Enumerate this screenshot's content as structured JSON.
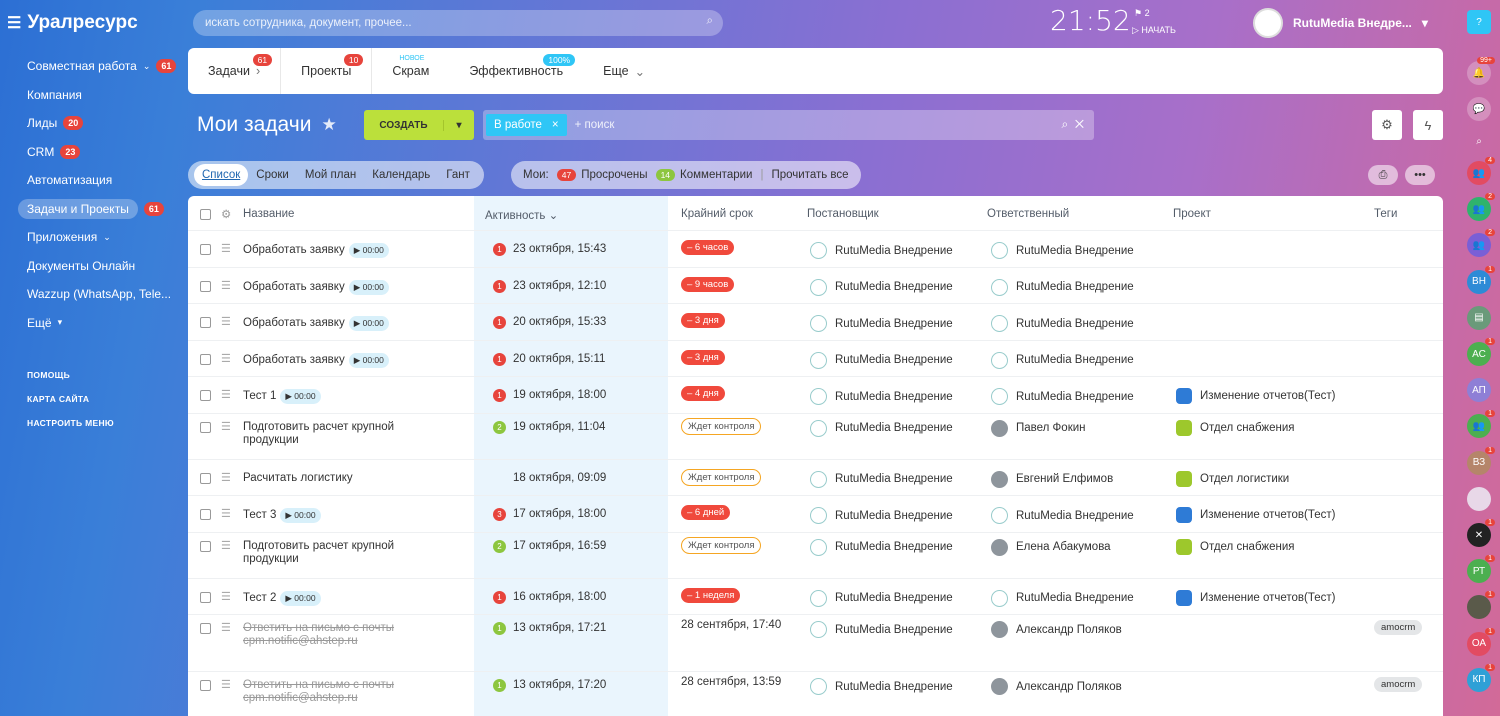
{
  "portal": {
    "title": "Уралресурс"
  },
  "left_menu": {
    "items": [
      {
        "label": "Совместная работа",
        "badge": "61",
        "chevron": "⌄"
      },
      {
        "label": "Компания",
        "badge": ""
      },
      {
        "label": "Лиды",
        "badge": "20"
      },
      {
        "label": "CRM",
        "badge": "23"
      },
      {
        "label": "Автоматизация",
        "badge": ""
      },
      {
        "label": "Задачи и Проекты",
        "badge": "61"
      },
      {
        "label": "Приложения",
        "badge": "",
        "chevron": "⌄"
      },
      {
        "label": "Документы Онлайн",
        "badge": ""
      },
      {
        "label": "Wazzup (WhatsApp, Tele...",
        "badge": ""
      },
      {
        "label": "Ещё",
        "badge": "",
        "chevron": "▾"
      }
    ],
    "small": [
      "ПОМОЩЬ",
      "КАРТА САЙТА",
      "НАСТРОИТЬ МЕНЮ"
    ]
  },
  "search": {
    "placeholder": "искать сотрудника, документ, прочее..."
  },
  "header": {
    "time": "21:52",
    "flag_count": "2",
    "start_label": "НАЧАТЬ",
    "user_name": "RutuMedia Внедре..."
  },
  "top_tabs": [
    {
      "label": "Задачи",
      "badge": "61",
      "badge_color": "#e7443c",
      "chev": "›"
    },
    {
      "label": "Проекты",
      "badge": "10",
      "badge_color": "#e7443c"
    },
    {
      "label": "Скрам",
      "badge": "НОВОЕ",
      "badge_color": "#2fc6f6"
    },
    {
      "label": "Эффективность",
      "badge": "100%",
      "badge_color": "#2fc6f6"
    },
    {
      "label": "Еще",
      "badge": "",
      "chev": "⌄"
    }
  ],
  "page": {
    "title": "Мои задачи",
    "create_label": "СОЗДАТЬ",
    "filter_chip": "В работе",
    "filter_placeholder": "+ поиск"
  },
  "views": [
    "Список",
    "Сроки",
    "Мой план",
    "Календарь",
    "Гант"
  ],
  "mine": {
    "label": "Мои:",
    "overdue_count": "47",
    "overdue_label": "Просрочены",
    "comments_count": "14",
    "comments_label": "Комментарии",
    "read_all": "Прочитать все"
  },
  "columns": {
    "name": "Название",
    "activity": "Активность",
    "deadline": "Крайний срок",
    "creator": "Постановщик",
    "responsible": "Ответственный",
    "project": "Проект",
    "tags": "Теги"
  },
  "tasks": [
    {
      "name": "Обработать заявку",
      "timer": "▶ 00:00",
      "count": "1",
      "count_color": "#e7443c",
      "activity": "23 октября, 15:43",
      "deadline": "– 6 часов",
      "dl_type": "red",
      "creator": "RutuMedia Внедрение",
      "responsible": "RutuMedia Внедрение",
      "resp_logo": true,
      "project": "",
      "project_color": "",
      "tag": "",
      "done": false
    },
    {
      "name": "Обработать заявку",
      "timer": "▶ 00:00",
      "count": "1",
      "count_color": "#e7443c",
      "activity": "23 октября, 12:10",
      "deadline": "– 9 часов",
      "dl_type": "red",
      "creator": "RutuMedia Внедрение",
      "responsible": "RutuMedia Внедрение",
      "resp_logo": true,
      "project": "",
      "project_color": "",
      "tag": "",
      "done": false
    },
    {
      "name": "Обработать заявку",
      "timer": "▶ 00:00",
      "count": "1",
      "count_color": "#e7443c",
      "activity": "20 октября, 15:33",
      "deadline": "– 3 дня",
      "dl_type": "red",
      "creator": "RutuMedia Внедрение",
      "responsible": "RutuMedia Внедрение",
      "resp_logo": true,
      "project": "",
      "project_color": "",
      "tag": "",
      "done": false
    },
    {
      "name": "Обработать заявку",
      "timer": "▶ 00:00",
      "count": "1",
      "count_color": "#e7443c",
      "activity": "20 октября, 15:11",
      "deadline": "– 3 дня",
      "dl_type": "red",
      "creator": "RutuMedia Внедрение",
      "responsible": "RutuMedia Внедрение",
      "resp_logo": true,
      "project": "",
      "project_color": "",
      "tag": "",
      "done": false
    },
    {
      "name": "Тест 1",
      "timer": "▶ 00:00",
      "count": "1",
      "count_color": "#e7443c",
      "activity": "19 октября, 18:00",
      "deadline": "– 4 дня",
      "dl_type": "red",
      "creator": "RutuMedia Внедрение",
      "responsible": "RutuMedia Внедрение",
      "resp_logo": true,
      "project": "Изменение отчетов(Тест)",
      "project_color": "#2e7bd6",
      "tag": "",
      "done": false
    },
    {
      "name": "Подготовить расчет крупной",
      "name2": "продукции",
      "timer": "",
      "count": "2",
      "count_color": "#8dc63f",
      "activity": "19 октября, 11:04",
      "deadline": "Ждет контроля",
      "dl_type": "wait",
      "creator": "RutuMedia Внедрение",
      "responsible": "Павел Фокин",
      "resp_logo": false,
      "project": "Отдел снабжения",
      "project_color": "#9dc82c",
      "tag": "",
      "done": false
    },
    {
      "name": "Расчитать логистику",
      "timer": "",
      "count": "",
      "count_color": "",
      "activity": "18 октября, 09:09",
      "deadline": "Ждет контроля",
      "dl_type": "wait",
      "creator": "RutuMedia Внедрение",
      "responsible": "Евгений Елфимов",
      "resp_logo": false,
      "project": "Отдел логистики",
      "project_color": "#9dc82c",
      "tag": "",
      "done": false
    },
    {
      "name": "Тест 3",
      "timer": "▶ 00:00",
      "count": "3",
      "count_color": "#e7443c",
      "activity": "17 октября, 18:00",
      "deadline": "– 6 дней",
      "dl_type": "red",
      "creator": "RutuMedia Внедрение",
      "responsible": "RutuMedia Внедрение",
      "resp_logo": true,
      "project": "Изменение отчетов(Тест)",
      "project_color": "#2e7bd6",
      "tag": "",
      "done": false
    },
    {
      "name": "Подготовить расчет крупной",
      "name2": "продукции",
      "timer": "",
      "count": "2",
      "count_color": "#8dc63f",
      "activity": "17 октября, 16:59",
      "deadline": "Ждет контроля",
      "dl_type": "wait",
      "creator": "RutuMedia Внедрение",
      "responsible": "Елена Абакумова",
      "resp_logo": false,
      "project": "Отдел снабжения",
      "project_color": "#9dc82c",
      "tag": "",
      "done": false
    },
    {
      "name": "Тест 2",
      "timer": "▶ 00:00",
      "count": "1",
      "count_color": "#e7443c",
      "activity": "16 октября, 18:00",
      "deadline": "– 1 неделя",
      "dl_type": "red",
      "creator": "RutuMedia Внедрение",
      "responsible": "RutuMedia Внедрение",
      "resp_logo": true,
      "project": "Изменение отчетов(Тест)",
      "project_color": "#2e7bd6",
      "tag": "",
      "done": false
    },
    {
      "name": "Ответить на письмо с почты",
      "name2": "cpm.notific@ahstep.ru",
      "timer": "",
      "count": "1",
      "count_color": "#8dc63f",
      "activity": "13 октября, 17:21",
      "deadline": "28 сентября, 17:40",
      "dl_type": "text",
      "creator": "RutuMedia Внедрение",
      "responsible": "Александр Поляков",
      "resp_logo": false,
      "project": "",
      "project_color": "",
      "tag": "amocrm",
      "done": true
    },
    {
      "name": "Ответить на письмо с почты",
      "name2": "cpm.notific@ahstep.ru",
      "timer": "",
      "count": "1",
      "count_color": "#8dc63f",
      "activity": "13 октября, 17:20",
      "deadline": "28 сентября, 13:59",
      "dl_type": "text",
      "creator": "RutuMedia Внедрение",
      "responsible": "Александр Поляков",
      "resp_logo": false,
      "project": "",
      "project_color": "",
      "tag": "amocrm",
      "done": true
    }
  ],
  "right_bar": [
    {
      "label": "?",
      "color": "#2fc6f6",
      "badge": ""
    },
    {
      "label": "🔔",
      "color": "rgba(255,255,255,.25)",
      "badge": "99+"
    },
    {
      "label": "💬",
      "color": "rgba(255,255,255,.25)",
      "badge": ""
    },
    {
      "label": "⌕",
      "color": "transparent",
      "badge": ""
    },
    {
      "label": "👥",
      "color": "#e24b62",
      "badge": "4"
    },
    {
      "label": "👥",
      "color": "#2fb36d",
      "badge": "2"
    },
    {
      "label": "👥",
      "color": "#7a5fd6",
      "badge": "2"
    },
    {
      "label": "ВН",
      "color": "#2e8bd6",
      "badge": "1"
    },
    {
      "label": "▤",
      "color": "#6a9a7a",
      "badge": ""
    },
    {
      "label": "АС",
      "color": "#4caf50",
      "badge": "1"
    },
    {
      "label": "АП",
      "color": "#8e7fd6",
      "badge": ""
    },
    {
      "label": "👥",
      "color": "#4caf50",
      "badge": "1"
    },
    {
      "label": "ВЗ",
      "color": "#b5856a",
      "badge": "1"
    },
    {
      "label": "",
      "color": "#e8d8e8",
      "badge": ""
    },
    {
      "label": "✕",
      "color": "#222",
      "badge": "1"
    },
    {
      "label": "РТ",
      "color": "#4caf50",
      "badge": "1"
    },
    {
      "label": "",
      "color": "#5a5a4a",
      "badge": "1"
    },
    {
      "label": "ОА",
      "color": "#e24b62",
      "badge": "1"
    },
    {
      "label": "КП",
      "color": "#2fa0d6",
      "badge": "1"
    }
  ]
}
